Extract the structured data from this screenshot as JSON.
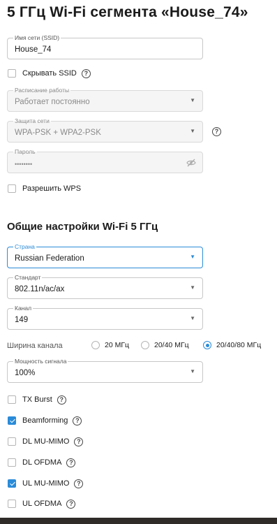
{
  "page_title": "5 ГГц Wi-Fi сегмента «House_74»",
  "ssid": {
    "label": "Имя сети (SSID)",
    "value": "House_74"
  },
  "hide_ssid": {
    "label": "Скрывать SSID",
    "checked": false
  },
  "schedule": {
    "label": "Расписание работы",
    "value": "Работает постоянно"
  },
  "security": {
    "label": "Защита сети",
    "value": "WPA-PSK + WPA2-PSK"
  },
  "password": {
    "label": "Пароль",
    "value": "••••••••"
  },
  "wps": {
    "label": "Разрешить WPS",
    "checked": false
  },
  "general_title": "Общие настройки Wi-Fi 5 ГГц",
  "country": {
    "label": "Страна",
    "value": "Russian Federation"
  },
  "standard": {
    "label": "Стандарт",
    "value": "802.11n/ac/ax"
  },
  "channel": {
    "label": "Канал",
    "value": "149"
  },
  "channel_width": {
    "label": "Ширина канала",
    "options": [
      "20 МГц",
      "20/40 МГц",
      "20/40/80 МГц"
    ],
    "selected": "20/40/80 МГц"
  },
  "power": {
    "label": "Мощность сигнала",
    "value": "100%"
  },
  "options": [
    {
      "label": "TX Burst",
      "checked": false
    },
    {
      "label": "Beamforming",
      "checked": true
    },
    {
      "label": "DL MU-MIMO",
      "checked": false
    },
    {
      "label": "DL OFDMA",
      "checked": false
    },
    {
      "label": "UL MU-MIMO",
      "checked": true
    },
    {
      "label": "UL OFDMA",
      "checked": false
    }
  ],
  "colors": {
    "accent": "#2a8bd8",
    "disabled_bg": "#f5f5f5",
    "border": "#c7c7c7"
  }
}
